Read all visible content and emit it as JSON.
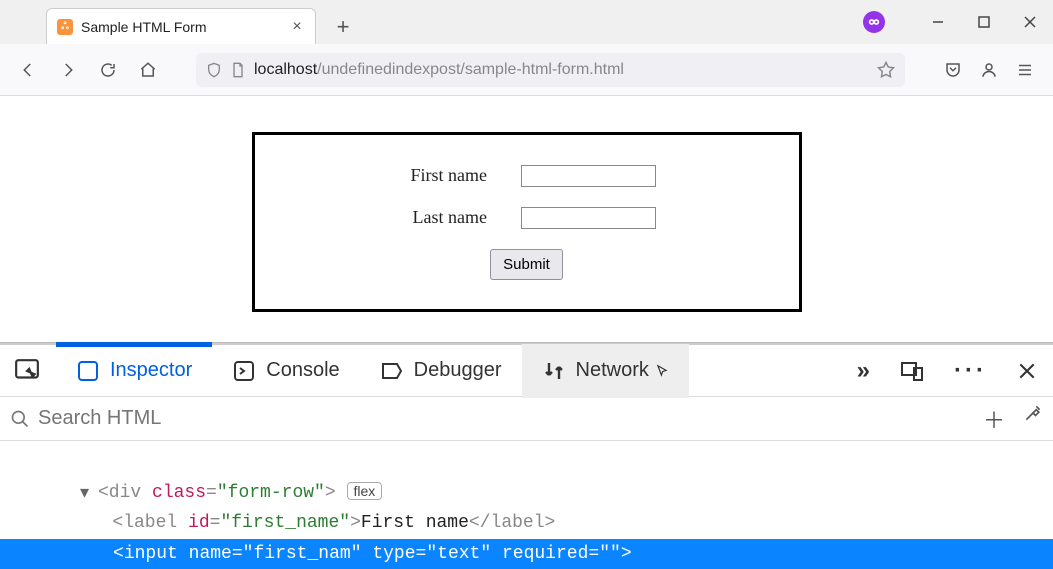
{
  "browser": {
    "tab_title": "Sample HTML Form",
    "url_host": "localhost",
    "url_path": "/undefinedindexpost/sample-html-form.html"
  },
  "form": {
    "first_name_label": "First name",
    "last_name_label": "Last name",
    "submit_label": "Submit"
  },
  "devtools": {
    "tabs": {
      "inspector": "Inspector",
      "console": "Console",
      "debugger": "Debugger",
      "network": "Network"
    },
    "search_placeholder": "Search HTML",
    "tree": {
      "div_open_pre": "<div ",
      "div_class_name": "class",
      "div_class_val": "\"form-row\"",
      "div_open_post": ">",
      "flex_badge": "flex",
      "label_open_pre": "<label ",
      "label_id_name": "id",
      "label_id_val": "\"first_name\"",
      "label_open_post": ">",
      "label_text": "First name",
      "label_close": "</label>",
      "input_open_pre": "<input ",
      "input_name_name": "name",
      "input_name_val": "\"first_nam\"",
      "input_type_name": "type",
      "input_type_val": "\"text\"",
      "input_req_name": "required",
      "input_req_val": "\"\"",
      "input_close": ">"
    }
  }
}
